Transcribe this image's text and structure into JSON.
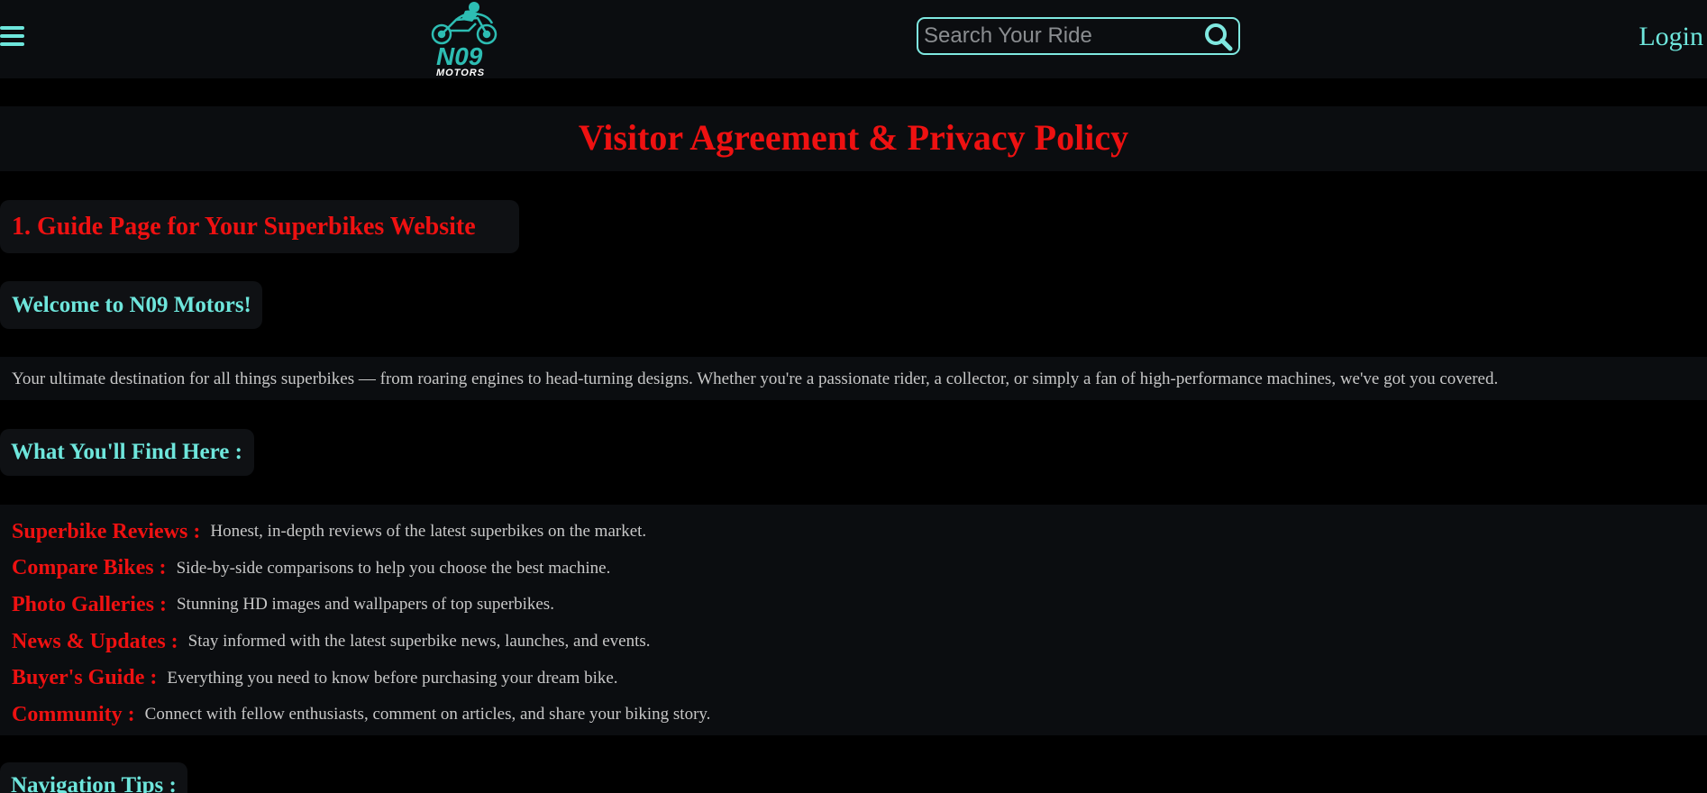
{
  "header": {
    "logo_text": "N09",
    "logo_subtext": "MOTORS",
    "search_placeholder": "Search Your Ride",
    "login_label": "Login"
  },
  "page": {
    "title": "Visitor Agreement & Privacy Policy"
  },
  "sections": {
    "guide_heading": "1. Guide Page for Your Superbikes Website",
    "welcome_heading": "Welcome to N09 Motors!",
    "intro_text": "Your ultimate destination for all things superbikes — from roaring engines to head-turning designs. Whether you're a passionate rider, a collector, or simply a fan of high-performance machines, we've got you covered.",
    "find_heading": "What You'll Find Here :",
    "features": [
      {
        "label": "Superbike Reviews :",
        "desc": "Honest, in-depth reviews of the latest superbikes on the market."
      },
      {
        "label": "Compare Bikes :",
        "desc": "Side-by-side comparisons to help you choose the best machine."
      },
      {
        "label": "Photo Galleries :",
        "desc": "Stunning HD images and wallpapers of top superbikes."
      },
      {
        "label": "News & Updates :",
        "desc": "Stay informed with the latest superbike news, launches, and events."
      },
      {
        "label": "Buyer's Guide :",
        "desc": "Everything you need to know before purchasing your dream bike."
      },
      {
        "label": "Community :",
        "desc": "Connect with fellow enthusiasts, comment on articles, and share your biking story."
      }
    ],
    "nav_heading": "Navigation Tips :"
  },
  "icons": {
    "menu": "hamburger-menu-icon",
    "search": "search-icon",
    "logo": "motorcycle-rider-logo"
  },
  "colors": {
    "background": "#000000",
    "panel": "#0b0d10",
    "accent_red": "#ee1111",
    "accent_teal": "#6ee6dc",
    "body_text": "#c7c7c7"
  }
}
